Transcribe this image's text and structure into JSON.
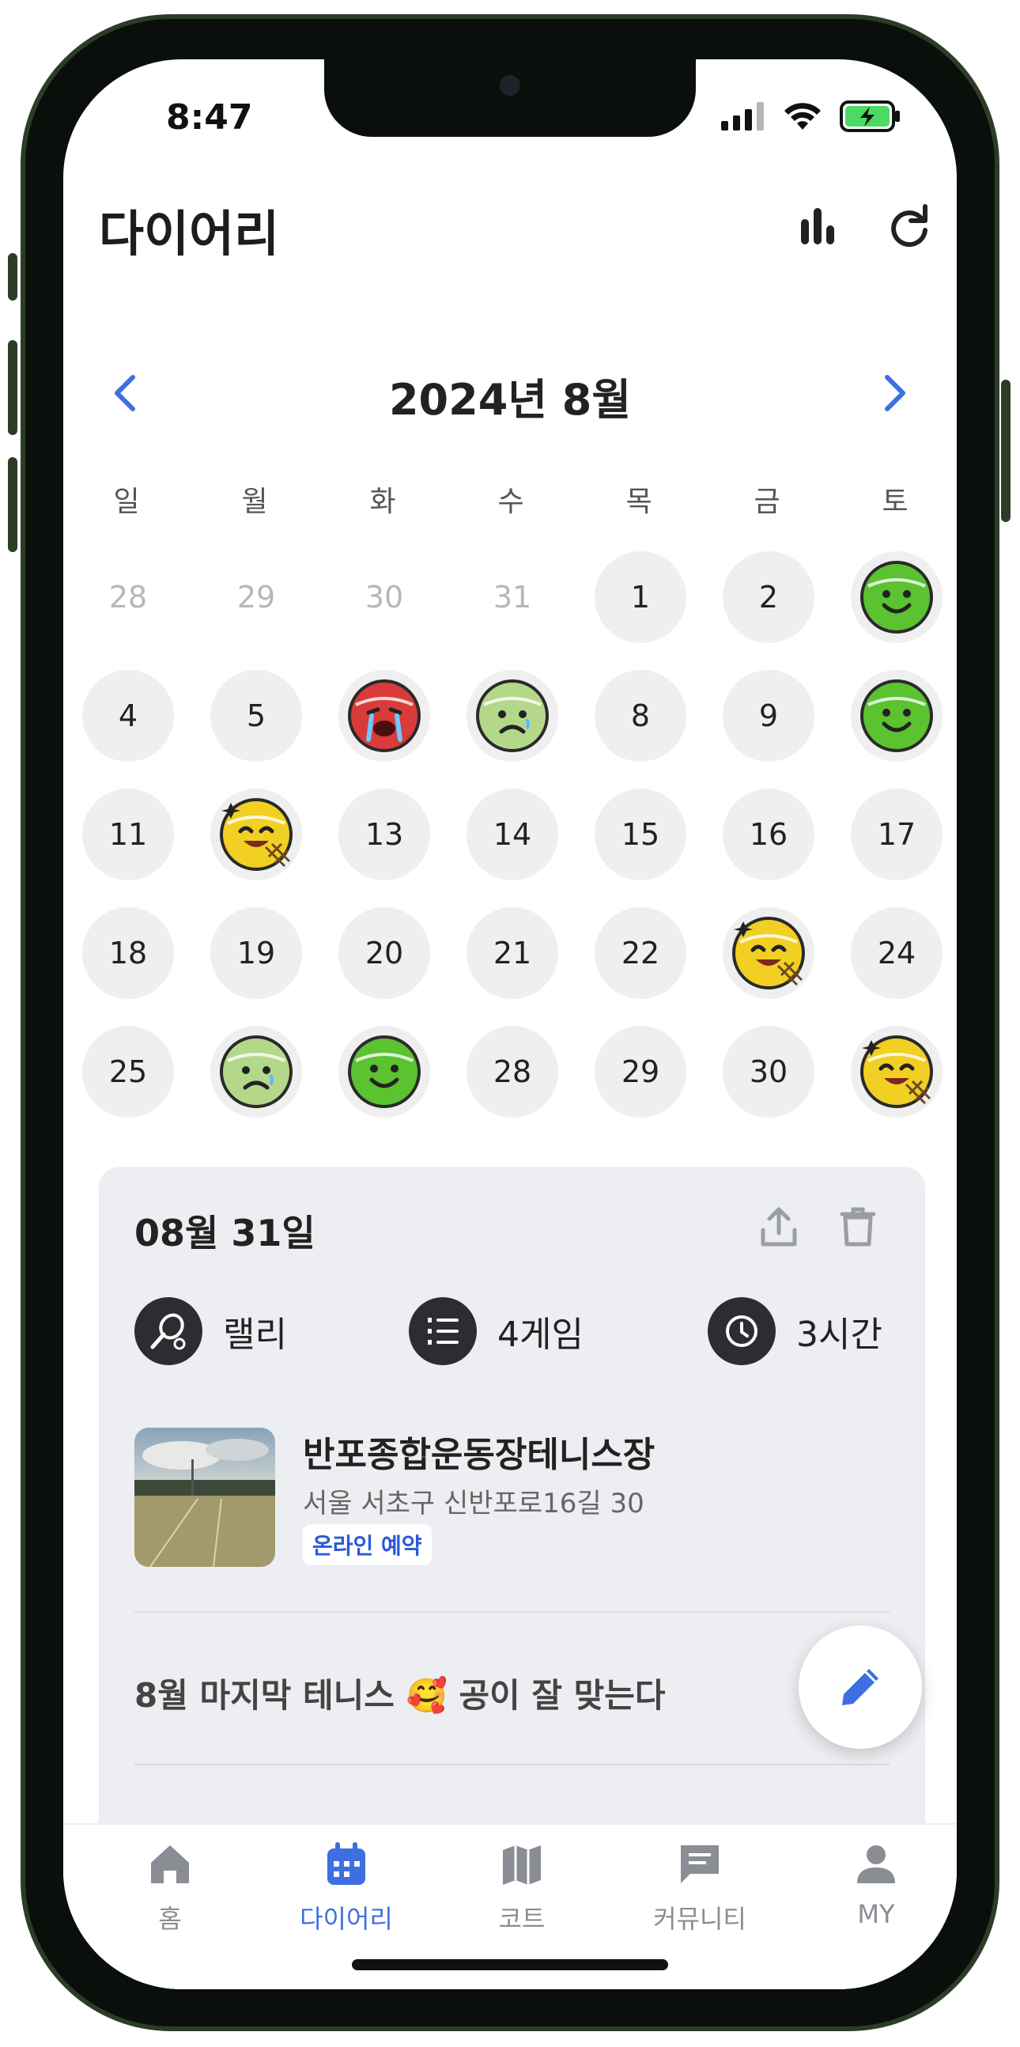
{
  "status_bar": {
    "time": "8:47"
  },
  "header": {
    "title": "다이어리"
  },
  "calendar": {
    "month_title": "2024년 8월",
    "weekdays": [
      "일",
      "월",
      "화",
      "수",
      "목",
      "금",
      "토"
    ],
    "rows": [
      [
        "28",
        "29",
        "30",
        "31",
        "1",
        "2",
        "emoji-happy"
      ],
      [
        "4",
        "5",
        "emoji-crying",
        "emoji-sad",
        "8",
        "9",
        "emoji-happy"
      ],
      [
        "11",
        "emoji-excited",
        "13",
        "14",
        "15",
        "16",
        "17"
      ],
      [
        "18",
        "19",
        "20",
        "21",
        "22",
        "emoji-excited",
        "24"
      ],
      [
        "25",
        "emoji-sad",
        "emoji-happy",
        "28",
        "29",
        "30",
        "emoji-excited"
      ]
    ]
  },
  "diary_card": {
    "date": "08월 31일",
    "stats": {
      "type": "랠리",
      "games": "4게임",
      "duration": "3시간"
    },
    "court": {
      "name": "반포종합운동장테니스장",
      "address": "서울 서초구 신반포로16길 30",
      "badge": "온라인 예약"
    },
    "memo": "8월 마지막 테니스 🥰 공이 잘 맞는다"
  },
  "tabs": [
    {
      "label": "홈",
      "icon": "home-icon"
    },
    {
      "label": "다이어리",
      "icon": "calendar-icon"
    },
    {
      "label": "코트",
      "icon": "map-icon"
    },
    {
      "label": "커뮤니티",
      "icon": "chat-icon"
    },
    {
      "label": "MY",
      "icon": "person-icon"
    }
  ],
  "colors": {
    "accent": "#3D6FE0",
    "card_bg": "#ECEEF1",
    "cell_bg": "#EFEFEF"
  }
}
